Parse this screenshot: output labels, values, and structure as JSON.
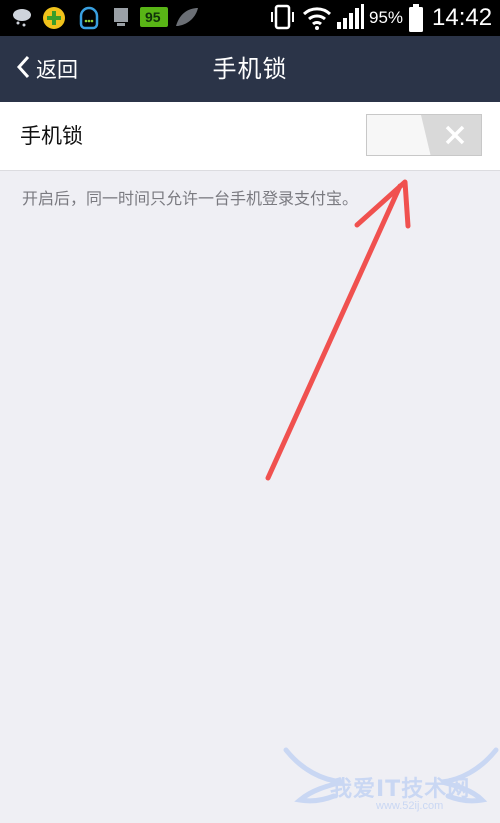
{
  "status_bar": {
    "battery_percent": "95%",
    "time": "14:42",
    "badge_number": "95",
    "icons": [
      "cloud-icon",
      "plus-shield-icon",
      "chat-bubble-icon",
      "sim-icon",
      "battery-badge-icon",
      "leaf-icon",
      "phone-vibrate-icon",
      "wifi-icon",
      "signal-icon",
      "battery-icon"
    ]
  },
  "header": {
    "back_label": "返回",
    "title": "手机锁",
    "background_color": "#2b3448"
  },
  "setting": {
    "label": "手机锁",
    "toggle_state": "off"
  },
  "hint": "开启后，同一时间只允许一台手机登录支付宝。",
  "watermark": {
    "text": "我爱IT技术网",
    "url": "www.52ij.com"
  },
  "colors": {
    "background": "#efeff4",
    "annotation_arrow": "#f0514f"
  }
}
